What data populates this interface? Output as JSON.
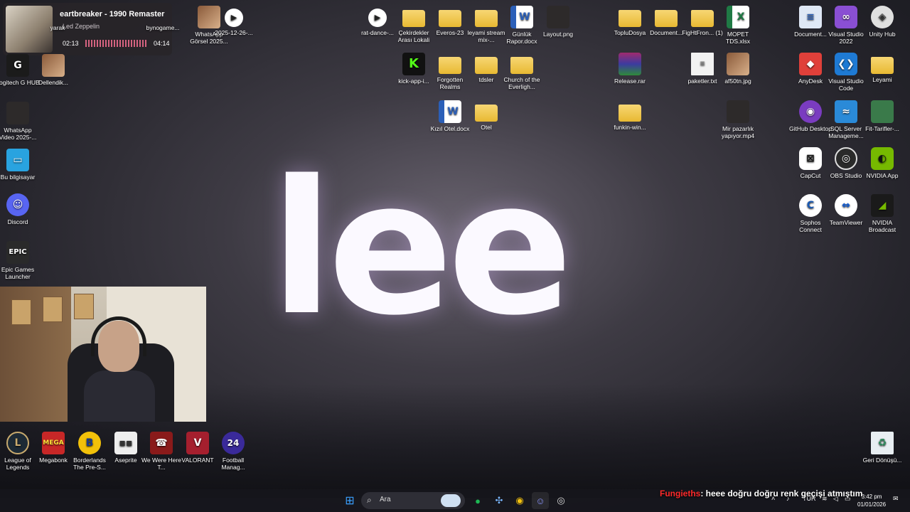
{
  "wallpaper": {
    "text": "lee"
  },
  "media": {
    "title": "eartbreaker - 1990 Remaster",
    "artist": "Led Zeppelin",
    "elapsed": "02:13",
    "duration": "04:14",
    "progress": 0.52
  },
  "desktop_left": [
    {
      "name": "yarak",
      "icon": "folder",
      "label": "yarak"
    },
    {
      "name": "bynogame",
      "icon": "folder",
      "label": "bynogame..."
    },
    {
      "name": "logitech-g-hub",
      "icon": "logitech-icon",
      "label": "Logitech G HUB"
    },
    {
      "name": "dellendik",
      "icon": "image-icon",
      "label": "Dellendik..."
    },
    {
      "name": "whatsapp-video",
      "icon": "video-thumb",
      "label": "WhatsApp Video 2025-..."
    },
    {
      "name": "bu-bilgisayar",
      "icon": "pc-icon",
      "label": "Bu bilgisayar"
    },
    {
      "name": "discord",
      "icon": "discord-icon",
      "label": "Discord"
    },
    {
      "name": "epic-games",
      "icon": "epic-icon",
      "label": "Epic Games Launcher"
    }
  ],
  "desktop_top": [
    {
      "name": "whatsapp-gorsel",
      "icon": "image",
      "label": "WhatsApp Görsel 2025..."
    },
    {
      "name": "video-2025",
      "icon": "video",
      "label": "2025-12-26-..."
    },
    {
      "name": "rat-dance",
      "icon": "video",
      "label": "rat-dance-..."
    },
    {
      "name": "cekirdekler",
      "icon": "folder",
      "label": "Çekirdekler Arası Lokali"
    },
    {
      "name": "everos",
      "icon": "folder",
      "label": "Everos-23"
    },
    {
      "name": "leyami-stream",
      "icon": "folder",
      "label": "leyami stream mix-..."
    },
    {
      "name": "gunluk-rapor",
      "icon": "word",
      "label": "Günlük Rapor.docx"
    },
    {
      "name": "layout-png",
      "icon": "image",
      "label": "Layout.png"
    },
    {
      "name": "kick-app",
      "icon": "kick",
      "label": "kick-app-i..."
    },
    {
      "name": "forgotten-realms",
      "icon": "folder",
      "label": "Forgotten Realms"
    },
    {
      "name": "tdsler",
      "icon": "folder",
      "label": "tdsler"
    },
    {
      "name": "church",
      "icon": "folder",
      "label": "Church of the Everligh..."
    },
    {
      "name": "kizil-otel",
      "icon": "word",
      "label": "Kızıl Otel.docx"
    },
    {
      "name": "otel",
      "icon": "folder",
      "label": "Otel"
    }
  ],
  "desktop_mid": [
    {
      "name": "toplu-dosya",
      "icon": "folder",
      "label": "TopluDosya"
    },
    {
      "name": "documents",
      "icon": "folder",
      "label": "Document..."
    },
    {
      "name": "fighfron",
      "icon": "folder",
      "label": "FigHtFron... (1)"
    },
    {
      "name": "mopet",
      "icon": "excel",
      "label": "MOPET TDS.xlsx"
    },
    {
      "name": "release-rar",
      "icon": "rar",
      "label": "Release.rar"
    },
    {
      "name": "paketler",
      "icon": "txt",
      "label": "paketler.txt"
    },
    {
      "name": "af50tn",
      "icon": "image",
      "label": "af50tn.jpg"
    },
    {
      "name": "funkin",
      "icon": "folder",
      "label": "funkin-win..."
    },
    {
      "name": "mir-pazarlik",
      "icon": "video",
      "label": "Mir pazarlık yapıyor.mp4"
    }
  ],
  "desktop_right": [
    {
      "name": "document-2",
      "icon": "doc",
      "label": "Document..."
    },
    {
      "name": "visual-studio",
      "icon": "vs",
      "label": "Visual Studio 2022"
    },
    {
      "name": "unity-hub",
      "icon": "unity",
      "label": "Unity Hub"
    },
    {
      "name": "anydesk",
      "icon": "anydesk",
      "label": "AnyDesk"
    },
    {
      "name": "vscode",
      "icon": "vscode",
      "label": "Visual Studio Code"
    },
    {
      "name": "leyami",
      "icon": "folder",
      "label": "Leyami"
    },
    {
      "name": "github-desktop",
      "icon": "github",
      "label": "GitHub Desktop"
    },
    {
      "name": "sql-server",
      "icon": "sql",
      "label": "SQL Server Manageme..."
    },
    {
      "name": "fit-tarifler",
      "icon": "fit",
      "label": "Fit-Tarifler-..."
    },
    {
      "name": "capcut",
      "icon": "capcut",
      "label": "CapCut"
    },
    {
      "name": "obs-studio",
      "icon": "obs",
      "label": "OBS Studio"
    },
    {
      "name": "nvidia-app",
      "icon": "nvidia",
      "label": "NVIDIA App"
    },
    {
      "name": "sophos",
      "icon": "sophos",
      "label": "Sophos Connect"
    },
    {
      "name": "teamviewer",
      "icon": "teamviewer",
      "label": "TeamViewer"
    },
    {
      "name": "nvidia-broadcast",
      "icon": "nvidia-broadcast",
      "label": "NVIDIA Broadcast"
    }
  ],
  "desktop_bottom": [
    {
      "name": "league-of-legends",
      "icon": "lol",
      "label": "League of Legends"
    },
    {
      "name": "megabonk",
      "icon": "megabonk",
      "label": "Megabonk"
    },
    {
      "name": "borderlands",
      "icon": "borderlands",
      "label": "Borderlands The Pre-S..."
    },
    {
      "name": "aseprite",
      "icon": "aseprite",
      "label": "Aseprite"
    },
    {
      "name": "we-were-here",
      "icon": "wwh",
      "label": "We Were Here T..."
    },
    {
      "name": "valorant",
      "icon": "valorant",
      "label": "VALORANT"
    },
    {
      "name": "football-manager",
      "icon": "fm",
      "label": "Football Manag..."
    },
    {
      "name": "recycle-bin",
      "icon": "bin",
      "label": "Geri Dönüşü..."
    }
  ],
  "taskbar": {
    "search_placeholder": "Ara",
    "language": "TUR",
    "time": "3:42 pm",
    "date": "01/01/2026"
  },
  "chat": {
    "user": "Fungieths",
    "message": ": heee doğru doğru renk geçişi atmıştım"
  }
}
